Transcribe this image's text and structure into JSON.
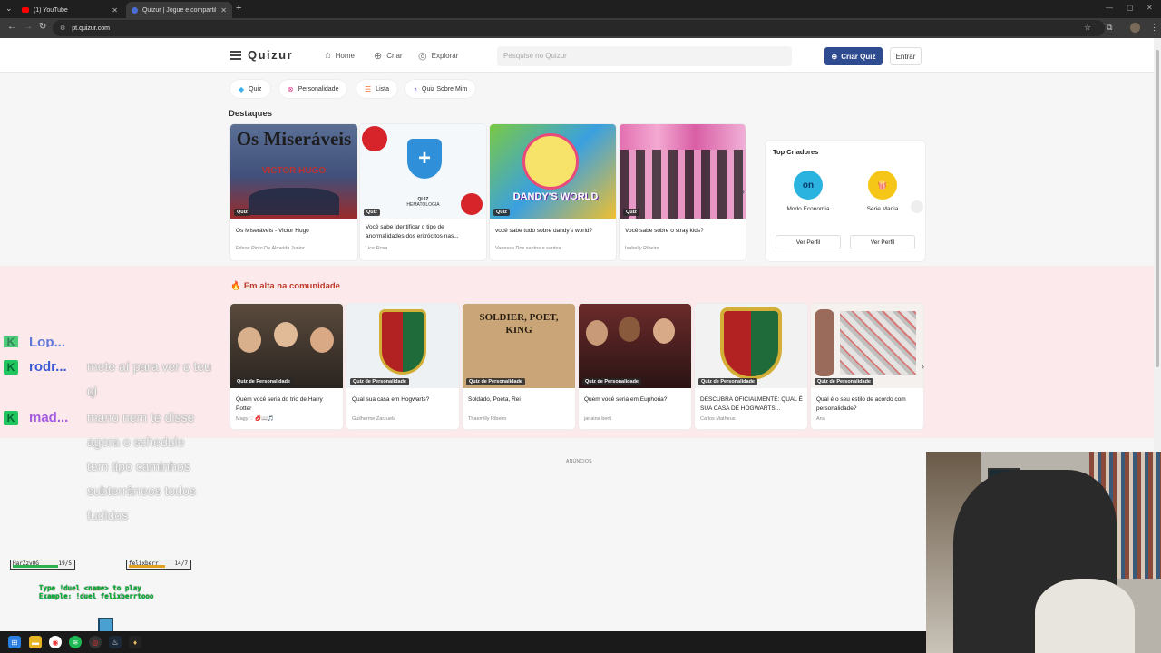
{
  "browser": {
    "tabs": [
      {
        "title": "(1) YouTube",
        "favicon_color": "#ff0000"
      },
      {
        "title": "Quizur | Jogue e compartilhe q",
        "favicon_color": "#4a6cd4"
      }
    ],
    "new_tab": "+",
    "url": "pt.quizur.com"
  },
  "header": {
    "logo": "Quizur",
    "nav": [
      {
        "label": "Home",
        "icon": "home-icon"
      },
      {
        "label": "Criar",
        "icon": "plus-circle-icon"
      },
      {
        "label": "Explorar",
        "icon": "compass-icon"
      }
    ],
    "search_placeholder": "Pesquise no Quizur",
    "create_button": "Criar Quiz",
    "login_button": "Entrar"
  },
  "categories": [
    {
      "label": "Quiz",
      "icon": "quiz-icon",
      "color": "#3bb0e8"
    },
    {
      "label": "Personalidade",
      "icon": "personality-icon",
      "color": "#e84393"
    },
    {
      "label": "Lista",
      "icon": "list-icon",
      "color": "#f07030"
    },
    {
      "label": "Quiz Sobre Mim",
      "icon": "about-me-icon",
      "color": "#7a5af0"
    }
  ],
  "highlights": {
    "title": "Destaques",
    "cards": [
      {
        "tag": "Quiz",
        "title": "Os Miseráveis - Victor Hugo",
        "author": "Edson Pinto De Almeida Junior",
        "thumb_text": "Os Miseráveis",
        "thumb_sub": "VICTOR HUGO"
      },
      {
        "tag": "Quiz",
        "title": "Você sabe identificar o tipo de anormalidades dos eritrócitos nas...",
        "author": "Lice Rosa",
        "thumb_text": "QUIZ",
        "thumb_sub": "HEMATOLOGIA"
      },
      {
        "tag": "Quiz",
        "title": "você sabe tudo sobre dandy's world?",
        "author": "Vanessa Dos santos e santos",
        "thumb_text": "DANDY'S WORLD",
        "thumb_sub": ""
      },
      {
        "tag": "Quiz",
        "title": "Você sabe sobre o stray kids?",
        "author": "Isabelly Ribeiro",
        "thumb_text": "",
        "thumb_sub": ""
      }
    ]
  },
  "top_creators": {
    "title": "Top Criadores",
    "creators": [
      {
        "name": "Modo Economia",
        "avatar_text": "on",
        "color": "#2bb3e0"
      },
      {
        "name": "Serie Mania",
        "avatar_text": "🍿",
        "color": "#f5c518"
      }
    ],
    "profile_button": "Ver Perfil"
  },
  "trending": {
    "title": "Em alta na comunidade",
    "cards": [
      {
        "tag": "Quiz de Personalidade",
        "title": "Quem você seria do trio de Harry Potter",
        "author": "Magy ♡ 💋📖🎵"
      },
      {
        "tag": "Quiz de Personalidade",
        "title": "Qual sua casa em Hogwarts?",
        "author": "Guilherme Zarzuela"
      },
      {
        "tag": "Quiz de Personalidade",
        "title": "Soldado, Poeta, Rei",
        "author": "Thaemilly Ribeiro",
        "thumb_text": "SOLDIER, POET, KING"
      },
      {
        "tag": "Quiz de Personalidade",
        "title": "Quem você seria em Euphoria?",
        "author": "janaina berti"
      },
      {
        "tag": "Quiz de Personalidade",
        "title": "DESCUBRA OFICIALMENTE: QUAL É SUA CASA DE HOGWARTS...",
        "author": "Carlos Matheus"
      },
      {
        "tag": "Quiz de Personalidade",
        "title": "Qual é o seu estilo de acordo com personalidade?",
        "author": "Ana"
      }
    ]
  },
  "ads_label": "ANÚNCIOS",
  "stream_overlay": {
    "chat": [
      {
        "user": "rodr...",
        "color": "#3b5bd6",
        "text": "mete aí para ver o teu qi"
      },
      {
        "user": "mad...",
        "color": "#a55be0",
        "text": "mano nem te disse agora o schedule tem tipo caminhos subterrâneos todos fudidos"
      }
    ],
    "partial_user": "Lop...",
    "hp_left": "HarZzyOG",
    "hp_left_value": "19/5",
    "hp_right": "felixberr",
    "hp_right_value": "14/7",
    "duel_line1": "Type !duel <name> to play",
    "duel_line2": "Example: !duel felixberrtooo"
  }
}
